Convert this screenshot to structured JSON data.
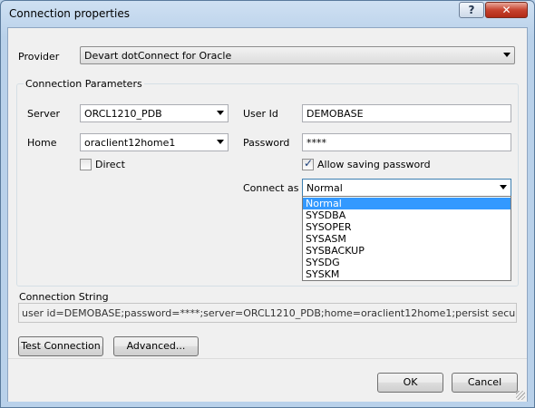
{
  "window": {
    "title": "Connection properties",
    "help_label": "?",
    "close_label": "✕"
  },
  "provider": {
    "label": "Provider",
    "value": "Devart dotConnect for Oracle"
  },
  "params": {
    "group_title": "Connection Parameters",
    "server_label": "Server",
    "server_value": "ORCL1210_PDB",
    "home_label": "Home",
    "home_value": "oraclient12home1",
    "direct_label": "Direct",
    "direct_checked": false,
    "userid_label": "User Id",
    "userid_value": "DEMOBASE",
    "password_label": "Password",
    "password_value": "****",
    "allow_saving_label": "Allow saving password",
    "allow_saving_checked": true,
    "connect_as_label": "Connect as",
    "connect_as_value": "Normal",
    "connect_as_options": [
      "Normal",
      "SYSDBA",
      "SYSOPER",
      "SYSASM",
      "SYSBACKUP",
      "SYSDG",
      "SYSKM"
    ]
  },
  "connection_string": {
    "label": "Connection String",
    "value": "user id=DEMOBASE;password=****;server=ORCL1210_PDB;home=oraclient12home1;persist security info=True"
  },
  "buttons": {
    "test_connection": "Test Connection",
    "advanced": "Advanced...",
    "ok": "OK",
    "cancel": "Cancel"
  },
  "colors": {
    "selection": "#3399ff",
    "title_bar": "#b9d1ea",
    "close_button": "#c7432f"
  }
}
